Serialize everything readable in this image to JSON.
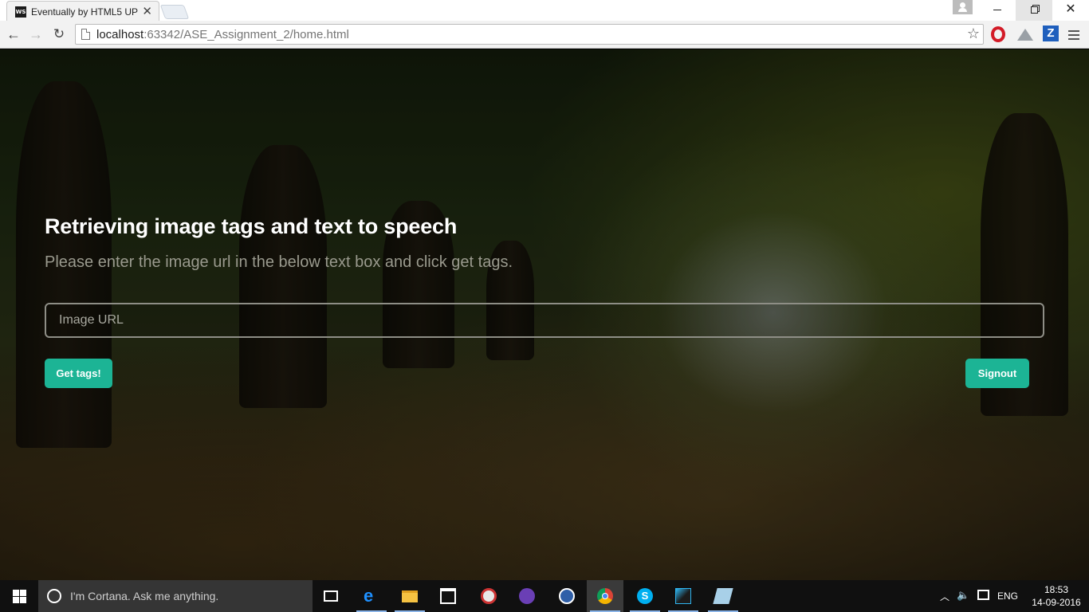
{
  "browser": {
    "tab_title": "Eventually by HTML5 UP",
    "tab_favicon_text": "WS",
    "url_host": "localhost",
    "url_rest": ":63342/ASE_Assignment_2/home.html",
    "extension_z_label": "Z"
  },
  "page": {
    "headline": "Retrieving image tags and text to speech",
    "subline": "Please enter the image url in the below text box and click get tags.",
    "input": {
      "placeholder": "Image URL",
      "value": ""
    },
    "get_tags_label": "Get tags!",
    "signout_label": "Signout",
    "accent_color": "#1cb495"
  },
  "taskbar": {
    "cortana_placeholder": "I'm Cortana. Ask me anything.",
    "apps": [
      "task-view",
      "edge",
      "file-explorer",
      "store",
      "app-red-round",
      "app-purple",
      "app-blue-tree",
      "chrome",
      "skype",
      "webstorm",
      "app-notepad"
    ],
    "active_app": "chrome",
    "language": "ENG",
    "time": "18:53",
    "date": "14-09-2016"
  }
}
